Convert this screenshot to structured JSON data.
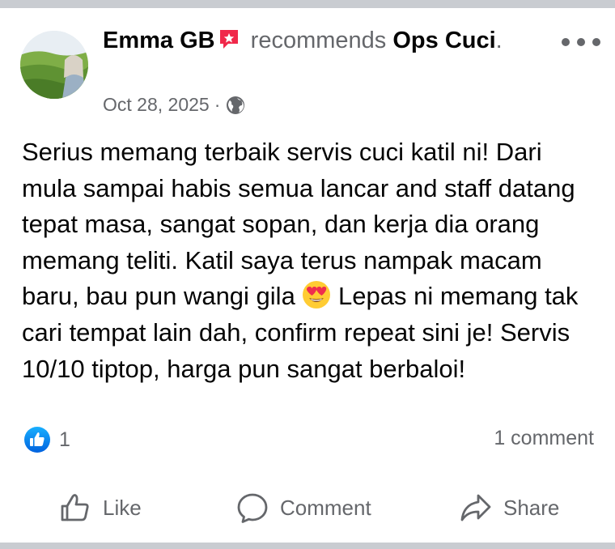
{
  "post": {
    "author": "Emma GB",
    "verb": "recommends",
    "page_name": "Ops Cuci",
    "period": ".",
    "date": "Oct 28, 2025",
    "separator": "·",
    "body_part1": "Serius memang terbaik servis cuci katil ni! Dari mula sampai habis semua lancar and staff datang tepat masa, sangat sopan, dan kerja dia orang memang teliti. Katil saya terus nampak macam baru, bau pun wangi gila ",
    "body_part2": " Lepas ni memang tak cari tempat lain dah, confirm repeat sini je! Servis 10/10 tiptop, harga pun sangat berbaloi!"
  },
  "reactions": {
    "count": "1",
    "comments": "1 comment"
  },
  "actions": {
    "like": "Like",
    "comment": "Comment",
    "share": "Share"
  },
  "icons": {
    "avatar": "avatar-photo",
    "badge": "recommendation-badge-icon",
    "globe": "globe-icon",
    "more": "more-options-icon",
    "emoji": "heart-eyes-emoji-icon",
    "like_badge": "thumbs-up-reaction-icon"
  },
  "colors": {
    "accent": "#1877f2",
    "secondary_text": "#65676b",
    "badge": "#f0284a"
  }
}
